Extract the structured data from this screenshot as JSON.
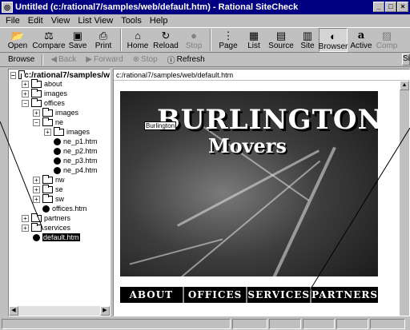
{
  "window": {
    "title": "Untitled (c:/rational7/samples/web/default.htm) - Rational SiteCheck",
    "minimize": "_",
    "maximize": "□",
    "close": "×"
  },
  "menu": [
    "File",
    "Edit",
    "View",
    "List View",
    "Tools",
    "Help"
  ],
  "toolbar": {
    "open": "Open",
    "compare": "Compare",
    "save": "Save",
    "print": "Print",
    "home": "Home",
    "reload": "Reload",
    "stop": "Stop",
    "page": "Page",
    "list": "List",
    "source": "Source",
    "site": "Site",
    "browser": "Browser",
    "active": "Active",
    "comp": "Comp"
  },
  "browsebar": {
    "label": "Browse",
    "back": "Back",
    "forward": "Forward",
    "stop": "Stop",
    "refresh": "Refresh",
    "right_cut": "Sit"
  },
  "tree": {
    "root": "c:/rational7/samples/w",
    "items": [
      {
        "label": "about",
        "type": "folder"
      },
      {
        "label": "images",
        "type": "folder"
      },
      {
        "label": "offices",
        "type": "folder-open"
      },
      {
        "label": "images",
        "type": "folder"
      },
      {
        "label": "ne",
        "type": "folder-open"
      },
      {
        "label": "images",
        "type": "folder"
      },
      {
        "label": "ne_p1.htm",
        "type": "page"
      },
      {
        "label": "ne_p2.htm",
        "type": "page"
      },
      {
        "label": "ne_p3.htm",
        "type": "page"
      },
      {
        "label": "ne_p4.htm",
        "type": "page"
      },
      {
        "label": "nw",
        "type": "folder"
      },
      {
        "label": "se",
        "type": "folder"
      },
      {
        "label": "sw",
        "type": "folder"
      },
      {
        "label": "offices.htm",
        "type": "page"
      },
      {
        "label": "partners",
        "type": "folder"
      },
      {
        "label": "services",
        "type": "folder"
      },
      {
        "label": "default.htm",
        "type": "page"
      }
    ]
  },
  "browser": {
    "url": "c:/rational7/samples/web/default.htm",
    "brand_title": "BURLINGTON",
    "brand_sub": "Movers",
    "tooltip": "Burlington",
    "nav": [
      "ABOUT",
      "OFFICES",
      "SERVICES",
      "PARTNERS"
    ]
  }
}
